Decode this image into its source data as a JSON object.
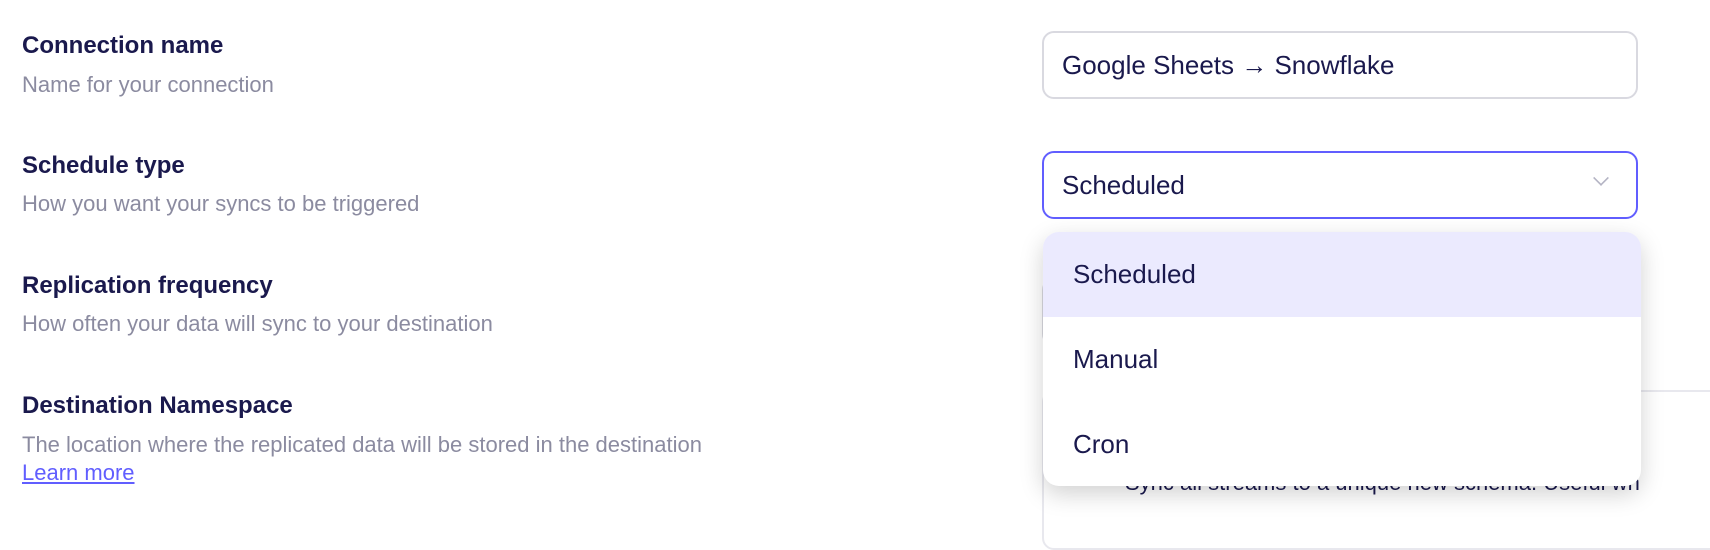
{
  "fields": {
    "connection_name": {
      "title": "Connection name",
      "description": "Name for your connection",
      "value": "Google Sheets → Snowflake"
    },
    "schedule_type": {
      "title": "Schedule type",
      "description": "How you want your syncs to be triggered",
      "value": "Scheduled"
    },
    "replication_frequency": {
      "title": "Replication frequency",
      "description": "How often your data will sync to your destination"
    },
    "destination_namespace": {
      "title": "Destination Namespace",
      "description": "The location where the replicated data will be stored in the destination",
      "link": "Learn more",
      "option_text": "Sync all streams to a unique new schema. Useful wh"
    }
  },
  "dropdown": {
    "options": [
      "Scheduled",
      "Manual",
      "Cron"
    ],
    "selected": "Scheduled"
  },
  "colors": {
    "accent": "#615eff",
    "text": "#1a194d",
    "muted": "#8b8ba0",
    "selected_bg": "#ebeafe"
  }
}
